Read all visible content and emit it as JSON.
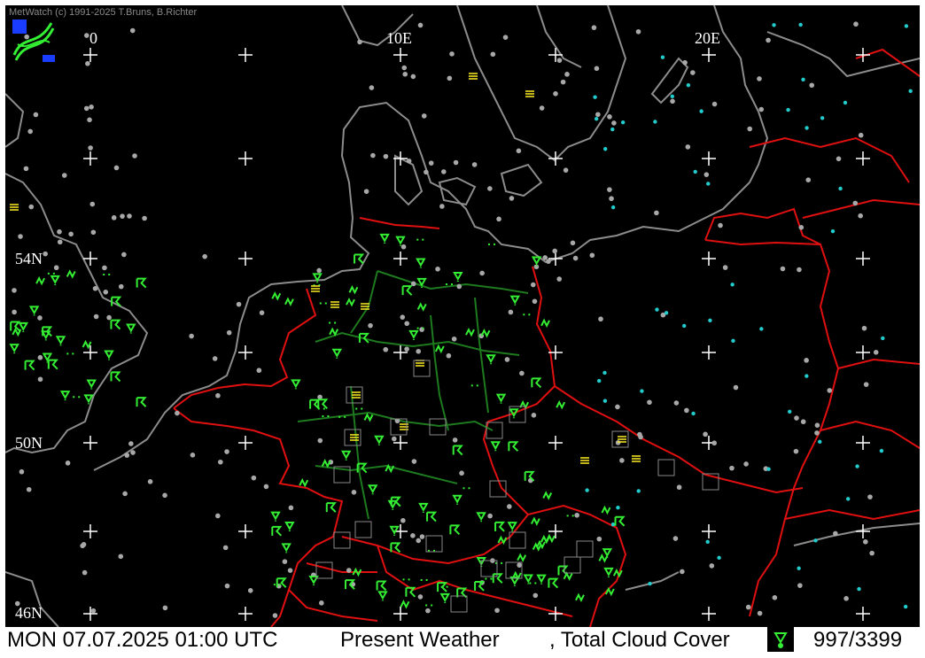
{
  "copyright": "MetWatch  (c) 1991-2025 T.Bruns, B.Richter",
  "grid": {
    "longitude_labels": [
      "0",
      "10E",
      "20E"
    ],
    "latitude_labels": [
      "54N",
      "50N",
      "46N"
    ]
  },
  "status_bar": {
    "datetime": "MON 07.07.2025 01:00 UTC",
    "parameter_1": "Present Weather",
    "parameter_2": ", Total Cloud Cover",
    "station_count": "997/3399"
  },
  "colors": {
    "background": "#000000",
    "coastline": "#8c8c8c",
    "country_border": "#e01010",
    "state_border": "#1e7a1e",
    "grid_cross": "#ffffff",
    "station_dot": "#a8a8a8",
    "weather_green": "#33ee33",
    "weather_yellow": "#ffee22",
    "station_cyan": "#22cccc"
  },
  "icons": [
    "metwatch-logo-icon",
    "grid-cross-icon",
    "station-circle-icon",
    "rain-shower-icon",
    "drizzle-icon",
    "fog-icon",
    "thunderstorm-icon",
    "haze-icon"
  ]
}
